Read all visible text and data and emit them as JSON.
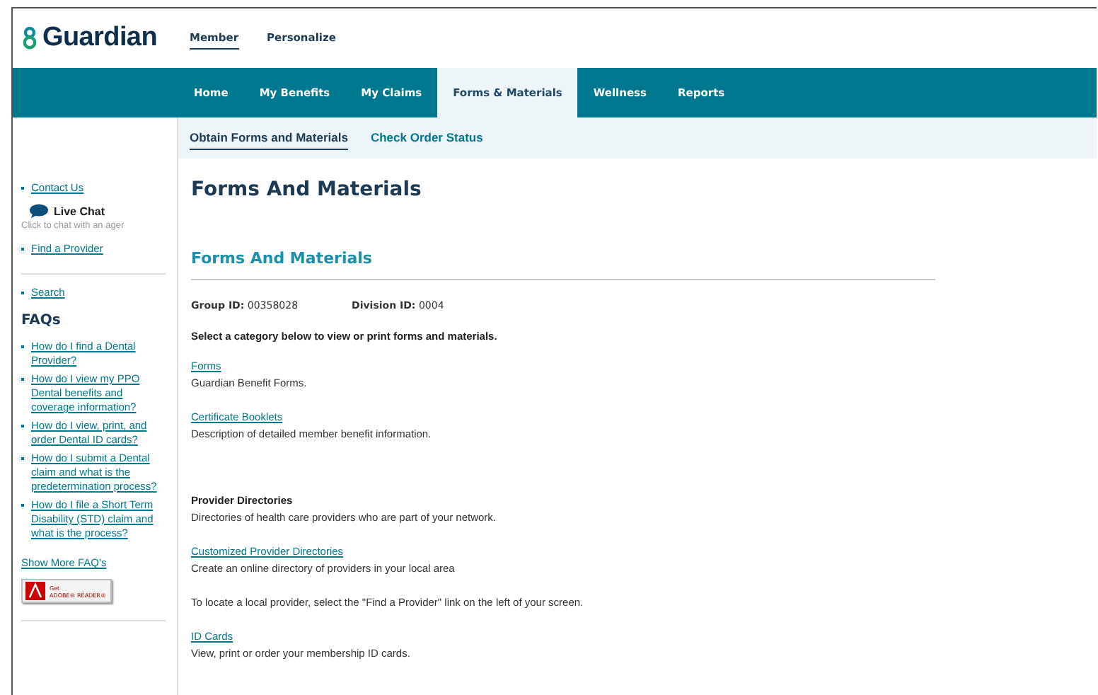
{
  "logo": {
    "text": "Guardian"
  },
  "top_tabs": [
    {
      "label": "Member",
      "selected": true
    },
    {
      "label": "Personalize",
      "selected": false
    }
  ],
  "nav": [
    {
      "label": "Home",
      "selected": false
    },
    {
      "label": "My Benefits",
      "selected": false
    },
    {
      "label": "My Claims",
      "selected": false
    },
    {
      "label": "Forms & Materials",
      "selected": true
    },
    {
      "label": "Wellness",
      "selected": false
    },
    {
      "label": "Reports",
      "selected": false
    }
  ],
  "subnav": [
    {
      "label": "Obtain Forms and Materials",
      "selected": true
    },
    {
      "label": "Check Order Status",
      "selected": false
    }
  ],
  "sidebar": {
    "contact": "Contact Us",
    "live_chat": {
      "title": "Live Chat",
      "hint": "Click to chat with an ager"
    },
    "find_provider": "Find a Provider",
    "search": "Search",
    "faq_title": "FAQs",
    "faqs": [
      "How do I find a Dental Provider?",
      "How do I view my PPO Dental benefits and coverage information?",
      "How do I view, print, and order Dental ID cards?",
      "How do I submit a Dental claim and what is the predetermination process?",
      "How do I file a Short Term Disability (STD) claim and what is the process?"
    ],
    "show_more": "Show More FAQ's",
    "adobe": {
      "line1": "Get",
      "line2": "ADOBE® READER®"
    }
  },
  "main": {
    "title": "Forms And Materials",
    "section_title": "Forms And Materials",
    "ids": [
      {
        "label": "Group ID:",
        "value": "00358028"
      },
      {
        "label": "Division ID:",
        "value": "0004"
      }
    ],
    "intro": "Select a category below to view or print forms and materials.",
    "items": [
      {
        "kind": "link",
        "title": "Forms",
        "text": "Guardian Benefit Forms."
      },
      {
        "kind": "link",
        "title": "Certificate Booklets",
        "text": "Description of detailed member benefit information."
      },
      {
        "kind": "heading",
        "title": "Provider Directories",
        "text": "Directories of health care providers who are part of your network."
      },
      {
        "kind": "link",
        "title": "Customized Provider Directories",
        "text": "Create an online directory of providers in your local area"
      },
      {
        "kind": "note",
        "text": "To locate a local provider, select the \"Find a Provider\" link on the left of your screen."
      },
      {
        "kind": "link",
        "title": "ID Cards",
        "text": "View, print or order your membership ID cards."
      }
    ]
  }
}
